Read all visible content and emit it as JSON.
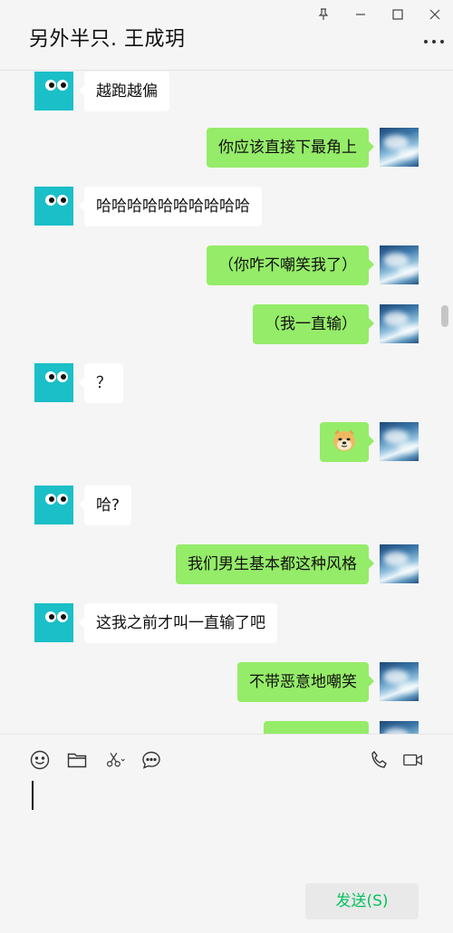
{
  "window": {
    "title": "另外半只. 王成玥",
    "controls": [
      "pin-icon",
      "minimize-icon",
      "maximize-icon",
      "close-icon"
    ]
  },
  "messages": [
    {
      "side": "in",
      "text": "越跑越偏"
    },
    {
      "side": "out",
      "text": "你应该直接下最角上"
    },
    {
      "side": "in",
      "text": "哈哈哈哈哈哈哈哈哈哈"
    },
    {
      "side": "out",
      "text": "（你咋不嘲笑我了）"
    },
    {
      "side": "out",
      "text": "（我一直输）"
    },
    {
      "side": "in",
      "text": "？"
    },
    {
      "side": "out",
      "text": "",
      "emoji": "doge"
    },
    {
      "side": "in",
      "text": "哈?"
    },
    {
      "side": "out",
      "text": "我们男生基本都这种风格"
    },
    {
      "side": "in",
      "text": "这我之前才叫一直输了吧"
    },
    {
      "side": "out",
      "text": "不带恶意地嘲笑"
    }
  ],
  "toolbar": {
    "left_icons": [
      "emoji-icon",
      "folder-icon",
      "scissors-icon",
      "chat-bubble-icon"
    ],
    "right_icons": [
      "phone-icon",
      "video-call-icon"
    ]
  },
  "input": {
    "value": ""
  },
  "send_button": {
    "label": "发送(S)"
  },
  "colors": {
    "bubble_out": "#95ec69",
    "bubble_in": "#ffffff",
    "send_text": "#07c160",
    "avatar_contact": "#1bbfc8"
  }
}
